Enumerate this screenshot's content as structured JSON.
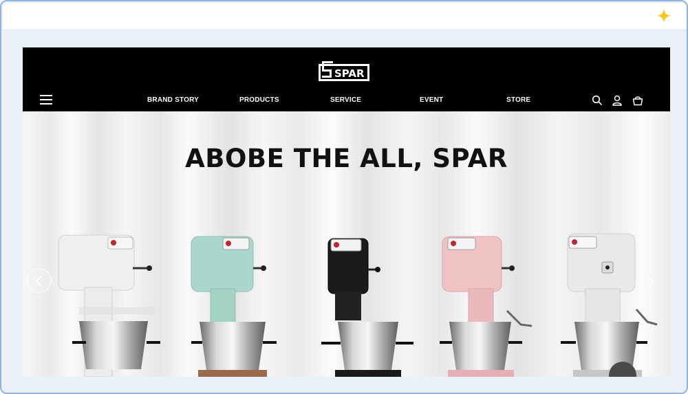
{
  "brand": {
    "logo_text": "SPAR"
  },
  "nav": {
    "items": [
      {
        "label": "BRAND STORY"
      },
      {
        "label": "PRODUCTS"
      },
      {
        "label": "SERVICE"
      },
      {
        "label": "EVENT"
      },
      {
        "label": "STORE"
      }
    ]
  },
  "icons": {
    "menu": "hamburger-menu-icon",
    "search": "search-icon",
    "account": "user-icon",
    "cart": "shopping-basket-icon",
    "browser": "sparkle-icon"
  },
  "hero": {
    "headline": "ABOBE THE ALL, SPAR",
    "products": [
      {
        "name": "mixer-white",
        "color": "#efefef"
      },
      {
        "name": "mixer-mint",
        "color": "#a9d7cb"
      },
      {
        "name": "mixer-black",
        "color": "#1b1b1b"
      },
      {
        "name": "mixer-pink",
        "color": "#efc2c4"
      },
      {
        "name": "mixer-light-gray",
        "color": "#e9e9e9"
      }
    ]
  },
  "colors": {
    "header_bg": "#000000",
    "frame_border": "#8fb3e6",
    "sparkle": "#f5c518"
  }
}
